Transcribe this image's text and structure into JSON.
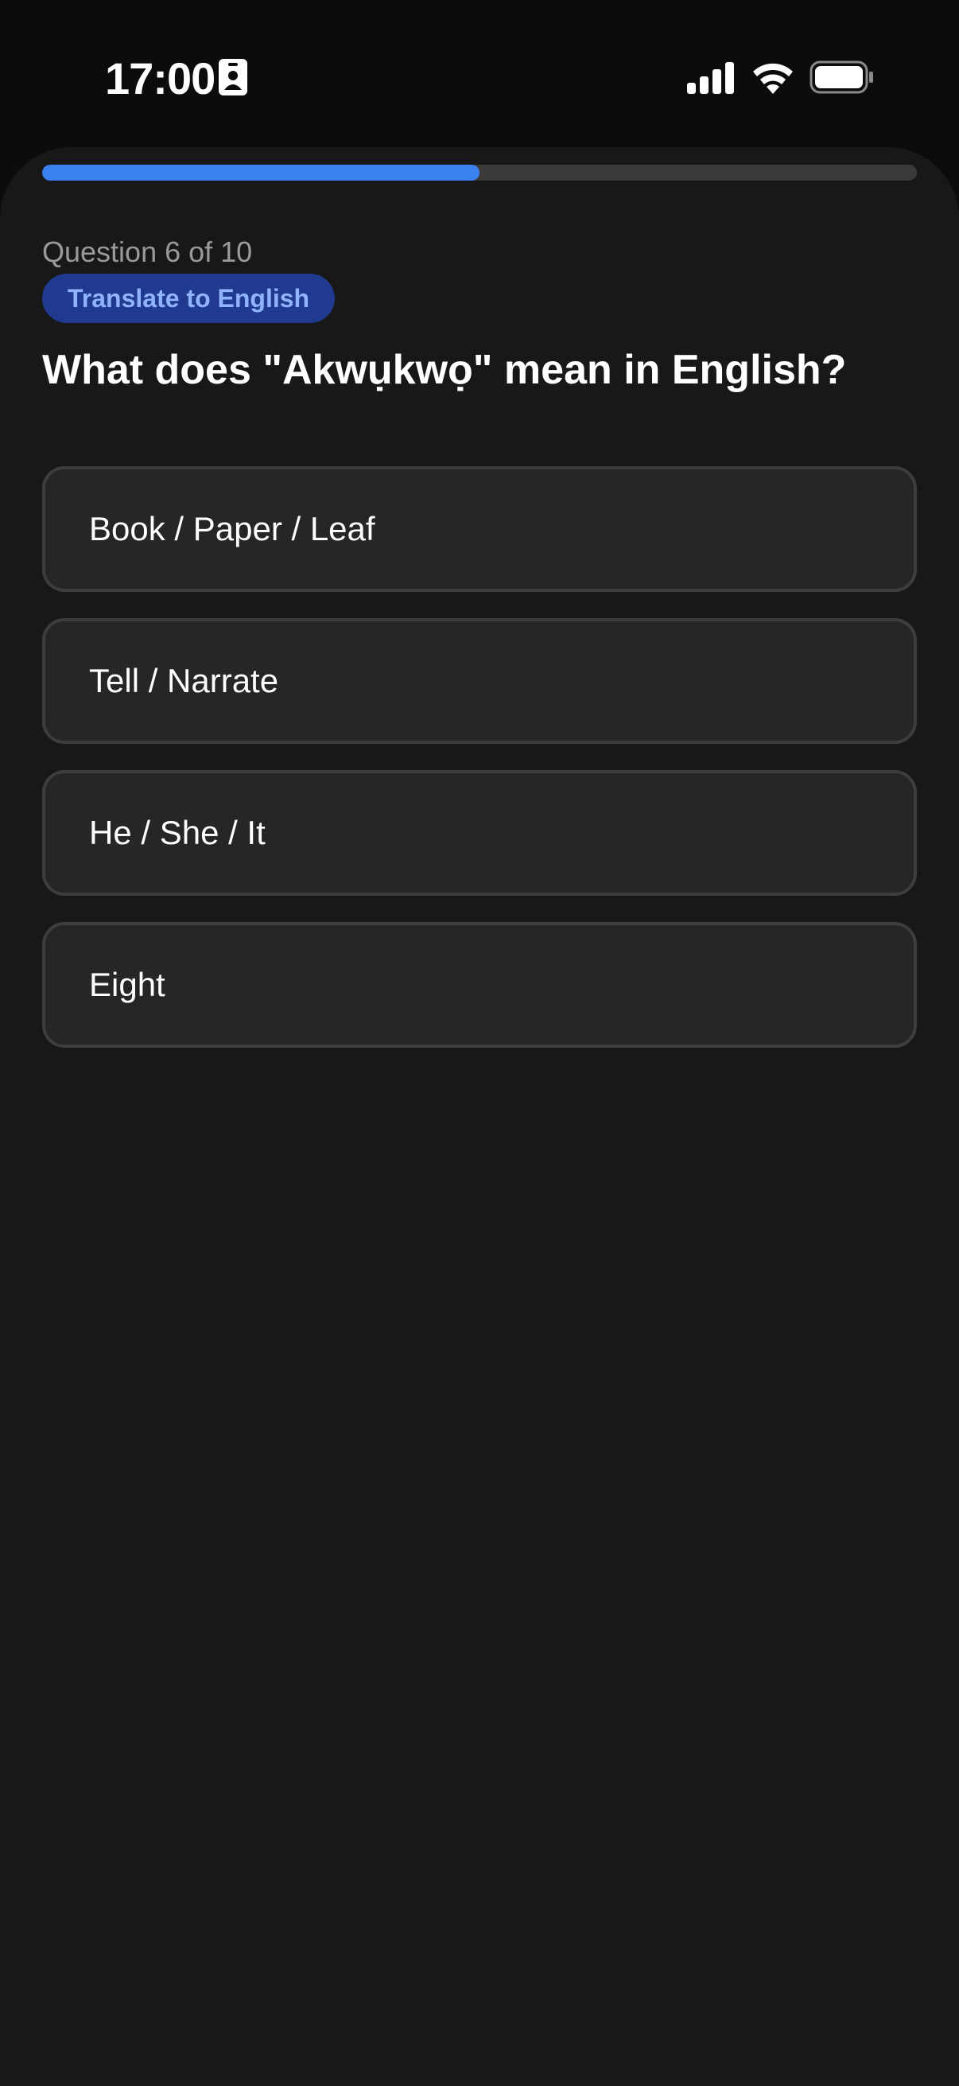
{
  "status_bar": {
    "time": "17:00",
    "icons": [
      "id-card-icon",
      "cellular-signal-icon",
      "wifi-icon",
      "battery-icon"
    ]
  },
  "quiz": {
    "progress_fraction": 0.5,
    "counter": "Question 6 of 10",
    "mode": "Translate to English",
    "question": "What does \"Akwụkwọ\" mean in English?",
    "options": [
      "Book / Paper / Leaf",
      "Tell / Narrate",
      "He / She / It",
      "Eight"
    ]
  },
  "colors": {
    "accent": "#3b82f0",
    "badge_bg": "#1f3a8f",
    "badge_text": "#8fb3ff",
    "background": "#181818",
    "option_bg": "#262626",
    "option_border": "#3d3d3d"
  }
}
